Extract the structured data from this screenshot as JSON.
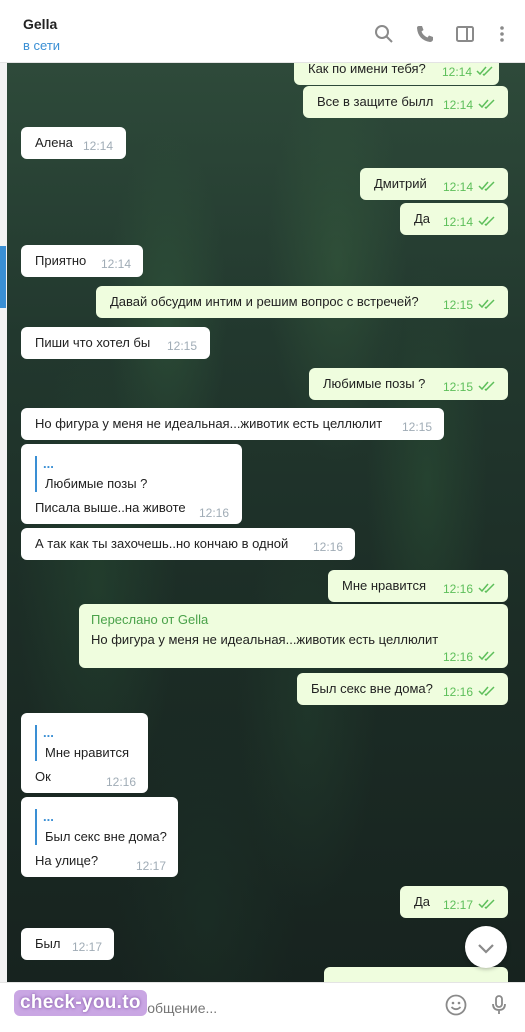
{
  "header": {
    "name": "Gella",
    "status": "в сети"
  },
  "messages": {
    "m1": {
      "text": "Как по имени тебя?",
      "time": "12:14"
    },
    "m2": {
      "text": "Все в защите былл",
      "time": "12:14"
    },
    "m3": {
      "text": "Алена",
      "time": "12:14"
    },
    "m4": {
      "text": "Дмитрий",
      "time": "12:14"
    },
    "m5": {
      "text": "Да",
      "time": "12:14"
    },
    "m6": {
      "text": "Приятно",
      "time": "12:14"
    },
    "m7": {
      "text": "Давай обсудим интим и решим вопрос с встречей?",
      "time": "12:15"
    },
    "m8": {
      "text": "Пиши что хотел бы",
      "time": "12:15"
    },
    "m9": {
      "text": "Любимые позы ?",
      "time": "12:15"
    },
    "m10": {
      "text": "Но фигура у меня не идеальная...животик есть целлюлит",
      "time": "12:15"
    },
    "m11": {
      "reply_dots": "...",
      "reply_text": "Любимые позы ?",
      "text": "Писала выше..на животе",
      "time": "12:16"
    },
    "m12": {
      "text": "А так как ты захочешь..но кончаю в одной",
      "time": "12:16"
    },
    "m13": {
      "text": "Мне  нравится",
      "time": "12:16"
    },
    "m14": {
      "fwd_title": "Переслано от Gella",
      "text": "Но фигура у меня не идеальная...животик есть целлюлит",
      "time": "12:16"
    },
    "m15": {
      "text": "Был секс вне дома?",
      "time": "12:16"
    },
    "m16": {
      "reply_dots": "...",
      "reply_text": "Мне  нравится",
      "text": "Ок",
      "time": "12:16"
    },
    "m17": {
      "reply_dots": "...",
      "reply_text": "Был секс вне дома?",
      "text": "На улице?",
      "time": "12:17"
    },
    "m18": {
      "text": "Да",
      "time": "12:17"
    },
    "m19": {
      "text": "Был",
      "time": "12:17"
    }
  },
  "input": {
    "placeholder": "Напишите сообщение..."
  },
  "watermark": {
    "text": "check-you.to"
  },
  "colors": {
    "accent": "#3a8fd4",
    "outgoing_bubble": "#effdde",
    "read_check": "#5dbf5a"
  },
  "icons": [
    "search-icon",
    "phone-icon",
    "sidebar-icon",
    "more-icon",
    "paperclip-icon",
    "emoji-icon",
    "mic-icon",
    "chevron-down-icon",
    "double-check-icon"
  ]
}
